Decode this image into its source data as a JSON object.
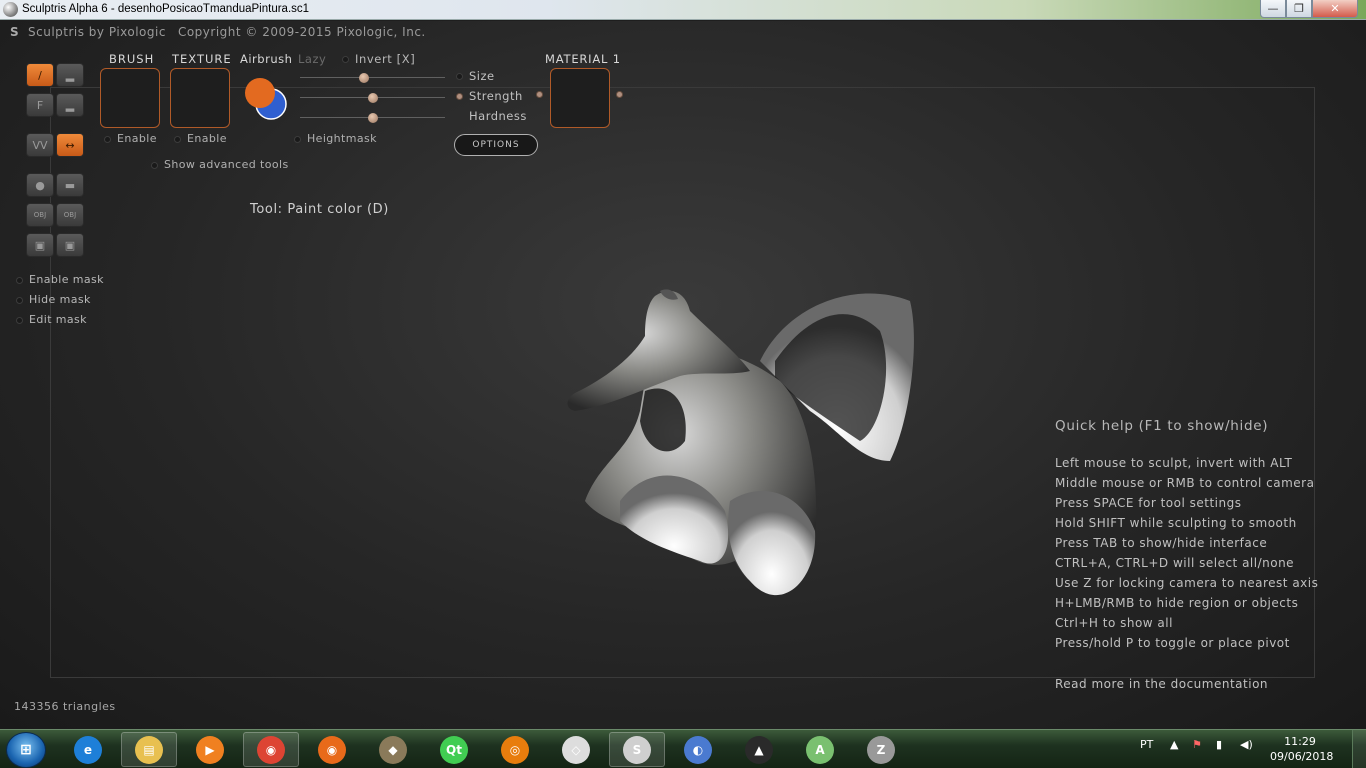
{
  "window": {
    "title": "Sculptris Alpha 6 - desenhoPosicaoTmanduaPintura.sc1",
    "minimize_label": "—",
    "maximize_label": "❐",
    "close_label": "✕"
  },
  "app": {
    "brand": "Sculptris by Pixologic",
    "copyright": "Copyright © 2009-2015 Pixologic, Inc."
  },
  "left_toolbar": {
    "tools": [
      {
        "name": "paint-brush",
        "glyph": "/"
      },
      {
        "name": "bump",
        "glyph": "▂"
      },
      {
        "name": "flatten",
        "glyph": "F"
      },
      {
        "name": "smooth-stroke",
        "glyph": "▂"
      },
      {
        "name": "wave",
        "glyph": "VV"
      },
      {
        "name": "symmetry",
        "glyph": "↔"
      },
      {
        "name": "sphere",
        "glyph": "●"
      },
      {
        "name": "plane",
        "glyph": "▬"
      },
      {
        "name": "import-obj",
        "glyph": "OBJ"
      },
      {
        "name": "export-obj",
        "glyph": "OBJ"
      },
      {
        "name": "save",
        "glyph": "▣"
      },
      {
        "name": "save-as",
        "glyph": "▣"
      }
    ],
    "mask_options": [
      "Enable mask",
      "Hide mask",
      "Edit mask"
    ]
  },
  "top_panel": {
    "brush_label": "BRUSH",
    "texture_label": "TEXTURE",
    "airbrush_label": "Airbrush",
    "lazy_label": "Lazy",
    "invert_label": "Invert [X]",
    "brush_enable": "Enable",
    "texture_enable": "Enable",
    "heightmask_label": "Heightmask",
    "show_advanced": "Show advanced tools",
    "sliders": [
      {
        "label": "Size",
        "value": 0.44
      },
      {
        "label": "Strength",
        "value": 0.5
      },
      {
        "label": "Hardness",
        "value": 0.5
      }
    ],
    "options_button": "OPTIONS",
    "material_label": "MATERIAL 1",
    "primary_color": "#e36a20",
    "secondary_color": "#2f5fd0"
  },
  "tool_status": "Tool: Paint color (D)",
  "quick_help": {
    "title": "Quick help (F1 to show/hide)",
    "items": [
      "Left mouse to sculpt, invert with ALT",
      "Middle mouse or RMB to control camera",
      "Press SPACE for tool settings",
      "Hold SHIFT while sculpting to smooth",
      "Press TAB to show/hide interface",
      "CTRL+A, CTRL+D will select all/none",
      "Use Z for locking camera to nearest axis",
      "H+LMB/RMB to hide region or objects",
      "Ctrl+H to show all",
      "Press/hold P to toggle or place pivot"
    ],
    "more": "Read more in the documentation"
  },
  "stats": {
    "triangles": "143356 triangles"
  },
  "taskbar": {
    "apps": [
      {
        "name": "internet-explorer",
        "glyph": "e",
        "color": "#1e7fd8"
      },
      {
        "name": "file-explorer",
        "glyph": "▤",
        "color": "#e8c050"
      },
      {
        "name": "media-player",
        "glyph": "▶",
        "color": "#f08020"
      },
      {
        "name": "chrome",
        "glyph": "◉",
        "color": "#dd4433"
      },
      {
        "name": "firefox",
        "glyph": "◉",
        "color": "#e86a1a"
      },
      {
        "name": "gimp",
        "glyph": "◆",
        "color": "#8a7a5a"
      },
      {
        "name": "qt-creator",
        "glyph": "Qt",
        "color": "#41cd52"
      },
      {
        "name": "blender",
        "glyph": "◎",
        "color": "#e87d0d"
      },
      {
        "name": "unity",
        "glyph": "◇",
        "color": "#dddddd"
      },
      {
        "name": "sculptris",
        "glyph": "S",
        "color": "#cfcfcf"
      },
      {
        "name": "photo-viewer",
        "glyph": "◐",
        "color": "#4a7ad0"
      },
      {
        "name": "inkscape",
        "glyph": "▲",
        "color": "#2a2a2a"
      },
      {
        "name": "android-studio",
        "glyph": "A",
        "color": "#7ac070"
      },
      {
        "name": "zbrush",
        "glyph": "Z",
        "color": "#999999"
      }
    ],
    "language": "PT",
    "time": "11:29",
    "date": "09/06/2018"
  }
}
